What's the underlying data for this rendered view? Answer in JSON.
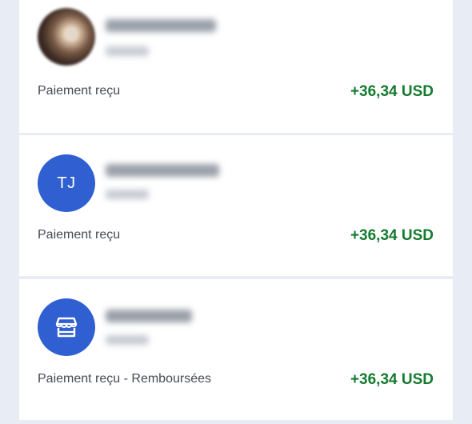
{
  "transactions": [
    {
      "avatar_type": "photo",
      "description": "Paiement reçu",
      "amount": "+36,34 USD"
    },
    {
      "avatar_type": "initials",
      "initials": "TJ",
      "description": "Paiement reçu",
      "amount": "+36,34 USD"
    },
    {
      "avatar_type": "icon",
      "icon": "store-icon",
      "description": "Paiement reçu - Remboursées",
      "amount": "+36,34 USD"
    }
  ],
  "colors": {
    "background": "#e8ecf5",
    "card": "#ffffff",
    "avatar_blue": "#2f5fd0",
    "amount_green": "#147a2e",
    "text_gray": "#444a55"
  }
}
